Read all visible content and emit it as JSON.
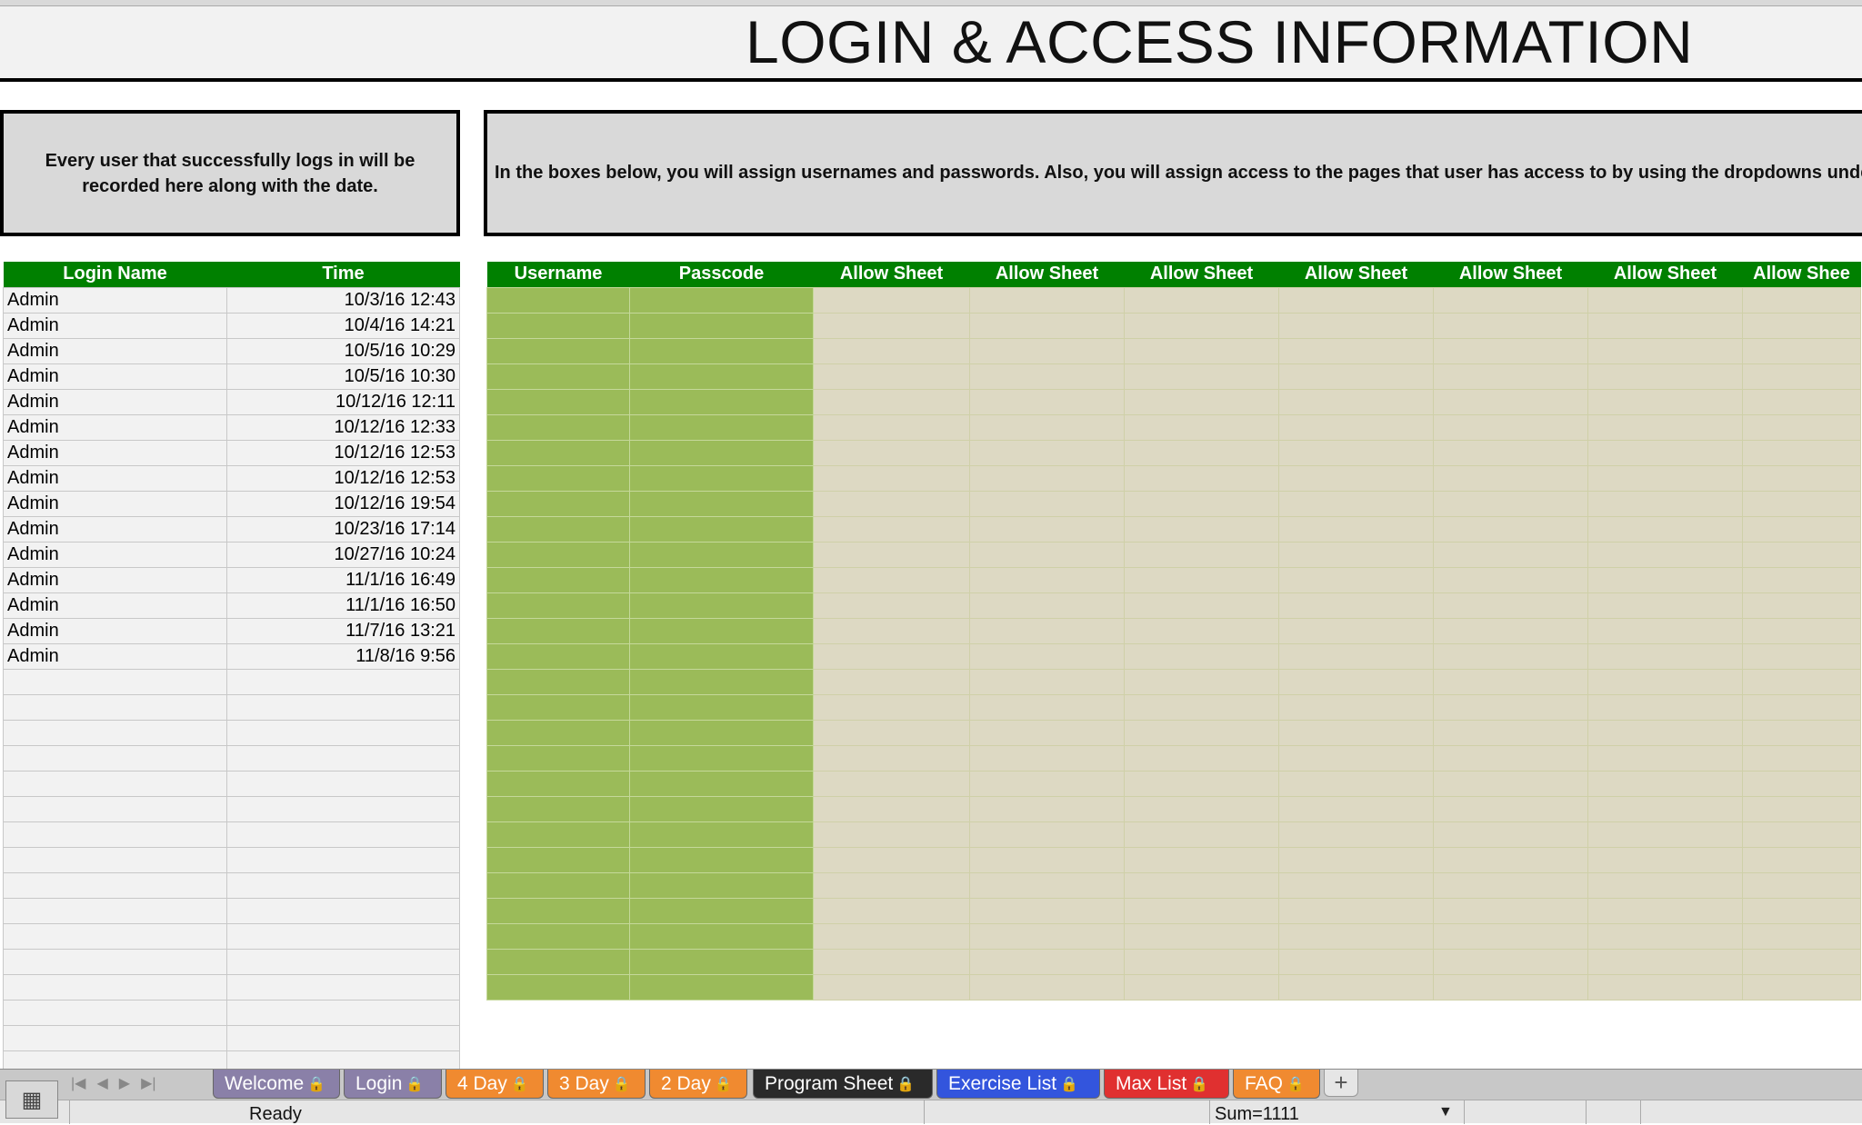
{
  "title": "LOGIN & ACCESS INFORMATION",
  "left_info": "Every user that successfully logs in will be recorded here along with the date.",
  "right_info": "In the boxes below, you will assign usernames and passwords.  Also, you will assign access to the pages that user has access to by using the dropdowns under \"Allow",
  "log_headers": [
    "Login Name",
    "Time"
  ],
  "log_rows": [
    [
      "Admin",
      "10/3/16 12:43"
    ],
    [
      "Admin",
      "10/4/16 14:21"
    ],
    [
      "Admin",
      "10/5/16 10:29"
    ],
    [
      "Admin",
      "10/5/16 10:30"
    ],
    [
      "Admin",
      "10/12/16 12:11"
    ],
    [
      "Admin",
      "10/12/16 12:33"
    ],
    [
      "Admin",
      "10/12/16 12:53"
    ],
    [
      "Admin",
      "10/12/16 12:53"
    ],
    [
      "Admin",
      "10/12/16 19:54"
    ],
    [
      "Admin",
      "10/23/16 17:14"
    ],
    [
      "Admin",
      "10/27/16 10:24"
    ],
    [
      "Admin",
      "11/1/16 16:49"
    ],
    [
      "Admin",
      "11/1/16 16:50"
    ],
    [
      "Admin",
      "11/7/16 13:21"
    ],
    [
      "Admin",
      "11/8/16 9:56"
    ]
  ],
  "access_headers": [
    "Username",
    "Passcode",
    "Allow Sheet",
    "Allow Sheet",
    "Allow Sheet",
    "Allow Sheet",
    "Allow Sheet",
    "Allow Sheet",
    "Allow Shee"
  ],
  "tabs": [
    {
      "label": "Welcome",
      "color": "#8a80a8"
    },
    {
      "label": "Login",
      "color": "#8a80a8"
    },
    {
      "label": "4 Day",
      "color": "#f08a30"
    },
    {
      "label": "3 Day",
      "color": "#f08a30"
    },
    {
      "label": "2 Day",
      "color": "#f08a30"
    },
    {
      "label": "Program Sheet",
      "color": "#2a2a2a"
    },
    {
      "label": "Exercise List",
      "color": "#3355dd"
    },
    {
      "label": "Max List",
      "color": "#e03030"
    },
    {
      "label": "FAQ",
      "color": "#f08a30"
    }
  ],
  "status": {
    "ready": "Ready",
    "sum": "Sum=1111"
  },
  "colors": {
    "header_green": "#008000",
    "cell_green": "#9bbb59",
    "cell_beige": "#ddd9c3"
  }
}
